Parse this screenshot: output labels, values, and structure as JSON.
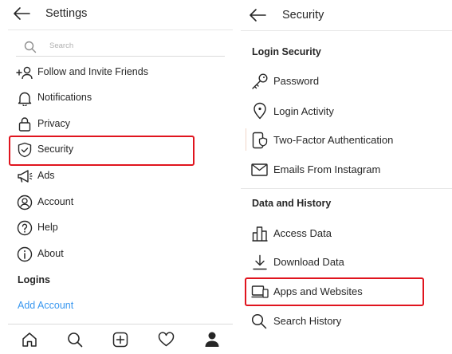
{
  "left": {
    "header": {
      "title": "Settings"
    },
    "search": {
      "placeholder": "Search"
    },
    "items": [
      {
        "label": "Follow and Invite Friends",
        "icon": "add-person-icon"
      },
      {
        "label": "Notifications",
        "icon": "bell-icon"
      },
      {
        "label": "Privacy",
        "icon": "lock-icon"
      },
      {
        "label": "Security",
        "icon": "shield-icon"
      },
      {
        "label": "Ads",
        "icon": "megaphone-icon"
      },
      {
        "label": "Account",
        "icon": "account-icon"
      },
      {
        "label": "Help",
        "icon": "help-icon"
      },
      {
        "label": "About",
        "icon": "info-icon"
      }
    ],
    "logins_title": "Logins",
    "add_account": "Add Account",
    "bottom_nav": [
      "home-icon",
      "search-icon",
      "new-post-icon",
      "heart-icon",
      "profile-icon"
    ]
  },
  "right": {
    "header": {
      "title": "Security"
    },
    "login_security": {
      "title": "Login Security",
      "items": [
        {
          "label": "Password",
          "icon": "key-icon"
        },
        {
          "label": "Login Activity",
          "icon": "location-pin-icon"
        },
        {
          "label": "Two-Factor Authentication",
          "icon": "phone-shield-icon"
        },
        {
          "label": "Emails From Instagram",
          "icon": "mail-icon"
        }
      ]
    },
    "data_history": {
      "title": "Data and History",
      "items": [
        {
          "label": "Access Data",
          "icon": "bar-chart-icon"
        },
        {
          "label": "Download Data",
          "icon": "download-icon"
        },
        {
          "label": "Apps and Websites",
          "icon": "devices-icon"
        },
        {
          "label": "Search History",
          "icon": "search-icon"
        }
      ]
    }
  },
  "colors": {
    "highlight": "#e0141e",
    "link": "#3897f0",
    "text": "#262626",
    "divider": "#e6e6e6"
  }
}
